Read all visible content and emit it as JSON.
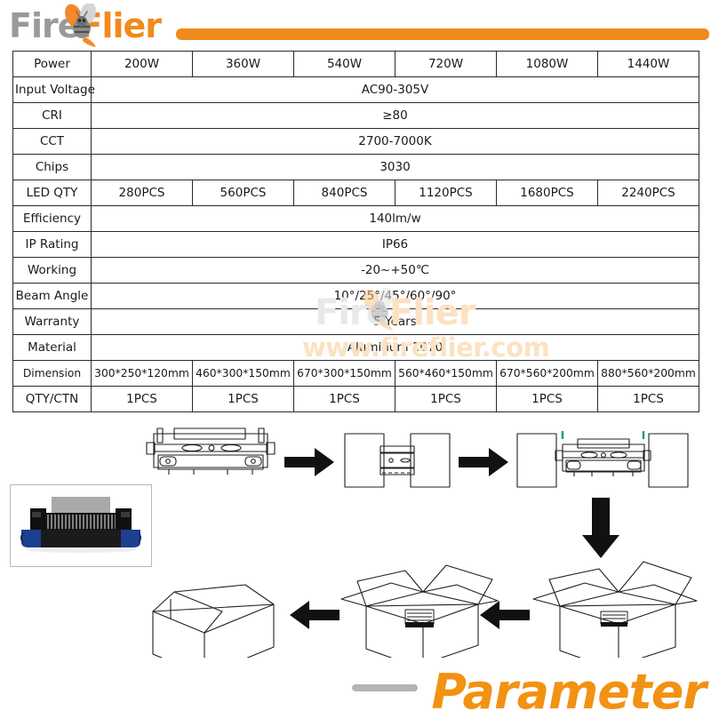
{
  "header": {
    "logo_part1": "Fire",
    "logo_part2": "Flier",
    "bee_icon": "bee-icon",
    "bar_color": "#f08a1c"
  },
  "watermark": {
    "brand_part1": "Fire",
    "brand_part2": "Flier",
    "url": "www.fireflier.com"
  },
  "spec_table": {
    "rows": [
      {
        "label": "Power",
        "merged": false,
        "values": [
          "200W",
          "360W",
          "540W",
          "720W",
          "1080W",
          "1440W"
        ]
      },
      {
        "label": "Input Voltage",
        "merged": true,
        "value": "AC90-305V"
      },
      {
        "label": "CRI",
        "merged": true,
        "value": "≥80"
      },
      {
        "label": "CCT",
        "merged": true,
        "value": "2700-7000K"
      },
      {
        "label": "Chips",
        "merged": true,
        "value": "3030"
      },
      {
        "label": "LED QTY",
        "merged": false,
        "values": [
          "280PCS",
          "560PCS",
          "840PCS",
          "1120PCS",
          "1680PCS",
          "2240PCS"
        ]
      },
      {
        "label": "Efficiency",
        "merged": true,
        "value": "140lm/w"
      },
      {
        "label": "IP Rating",
        "merged": true,
        "value": "IP66"
      },
      {
        "label": "Working",
        "merged": true,
        "value": "-20~+50℃"
      },
      {
        "label": "Beam Angle",
        "merged": true,
        "value": "10°/25°/45°/60°/90°"
      },
      {
        "label": "Warranty",
        "merged": true,
        "value": "5 Years"
      },
      {
        "label": "Material",
        "merged": true,
        "value": "Aluminum 1070"
      },
      {
        "label": "Dimension",
        "merged": false,
        "values": [
          "300*250*120mm",
          "460*300*150mm",
          "670*300*150mm",
          "560*460*150mm",
          "670*560*200mm",
          "880*560*200mm"
        ]
      },
      {
        "label": "QTY/CTN",
        "merged": false,
        "values": [
          "1PCS",
          "1PCS",
          "1PCS",
          "1PCS",
          "1PCS",
          "1PCS"
        ]
      }
    ]
  },
  "diagram": {
    "title": "packaging-steps",
    "steps": [
      "led-flood-light",
      "foam-end-caps-attached",
      "foam-caps-with-light",
      "open-carton-with-product",
      "closed-sealed-carton"
    ],
    "arrows": [
      "right",
      "right",
      "down",
      "left",
      "left"
    ]
  },
  "product_photo": {
    "alt": "led-flood-light-side-view",
    "body_color": "#1c1c1c",
    "bracket_color": "#1c3f8f",
    "heatsink_color": "#a8a8a8"
  },
  "footer": {
    "title": "Parameter",
    "title_color": "#f29212",
    "bar_color": "#b4b4b4"
  }
}
